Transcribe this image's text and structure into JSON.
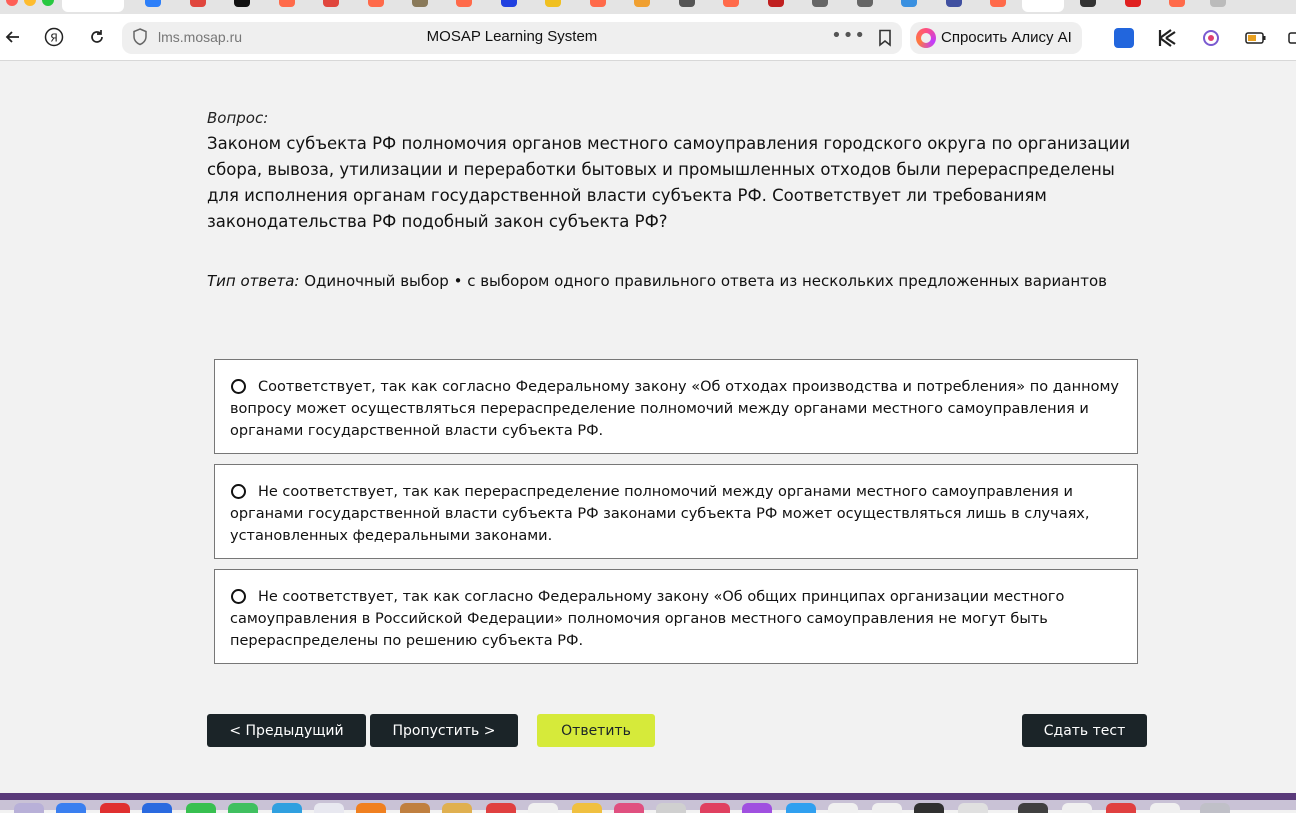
{
  "browser": {
    "url": "lms.mosap.ru",
    "page_title": "MOSAP Learning System",
    "alice_button": "Спросить Алису AI"
  },
  "question": {
    "label": "Вопрос:",
    "text": "Законом субъекта РФ полномочия органов местного самоуправления городского округа по организации сбора, вывоза, утилизации и переработки бытовых и промышленных отходов были перераспределены для исполнения органам государственной власти субъекта РФ. Соответствует ли требованиям законодательства РФ подобный закон субъекта РФ?",
    "answer_type_label": "Тип ответа:",
    "answer_type": "Одиночный выбор • с выбором одного правильного ответа из нескольких предложенных вариантов"
  },
  "options": [
    {
      "text": "Соответствует, так как согласно Федеральному закону «Об отходах производства и потребления» по данному вопросу может осуществляться перераспределение полномочий между органами местного самоуправления и органами государственной власти субъекта РФ."
    },
    {
      "text": "Не соответствует, так как перераспределение полномочий между органами местного самоуправления и органами государственной власти субъекта РФ законами субъекта РФ может осуществляться лишь в случаях, установленных федеральными законами."
    },
    {
      "text": "Не соответствует, так как согласно Федеральному закону «Об общих принципах организации местного самоуправления в Российской Федерации» полномочия органов местного самоуправления не могут быть перераспределены по решению субъекта РФ."
    }
  ],
  "buttons": {
    "prev": "< Предыдущий",
    "skip": "Пропустить >",
    "answer": "Ответить",
    "submit": "Сдать тест"
  },
  "colors": {
    "accent_lime": "#d6ea3a",
    "dark_button": "#1b2428",
    "page_background": "#f2f2f2"
  }
}
